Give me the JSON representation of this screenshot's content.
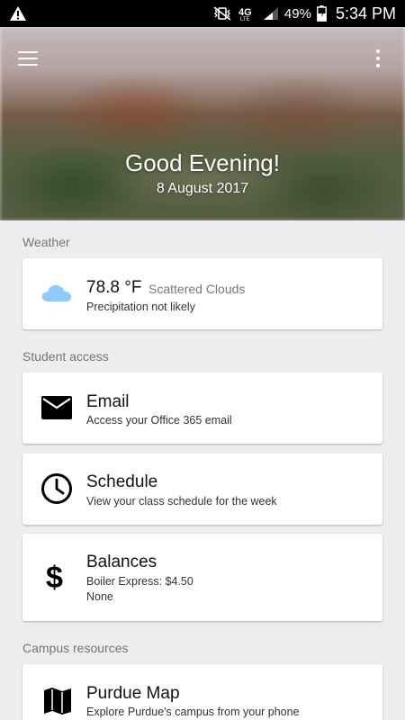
{
  "status_bar": {
    "battery": "49%",
    "time": "5:34 PM",
    "network": "4G LTE"
  },
  "header": {
    "greeting": "Good Evening!",
    "date": "8 August 2017"
  },
  "weather_section": {
    "title": "Weather",
    "temperature": "78.8 °F",
    "condition": "Scattered Clouds",
    "precipitation": "Precipitation not likely"
  },
  "student_access": {
    "title": "Student access",
    "email": {
      "title": "Email",
      "subtitle": "Access your Office 365 email"
    },
    "schedule": {
      "title": "Schedule",
      "subtitle": "View your class schedule for the week"
    },
    "balances": {
      "title": "Balances",
      "line1": "Boiler Express: $4.50",
      "line2": "None"
    }
  },
  "campus_resources": {
    "title": "Campus resources",
    "map": {
      "title": "Purdue Map",
      "subtitle": "Explore Purdue's campus from your phone"
    }
  },
  "colors": {
    "cloud": "#90caf9",
    "background": "#ededed",
    "card": "#ffffff"
  }
}
